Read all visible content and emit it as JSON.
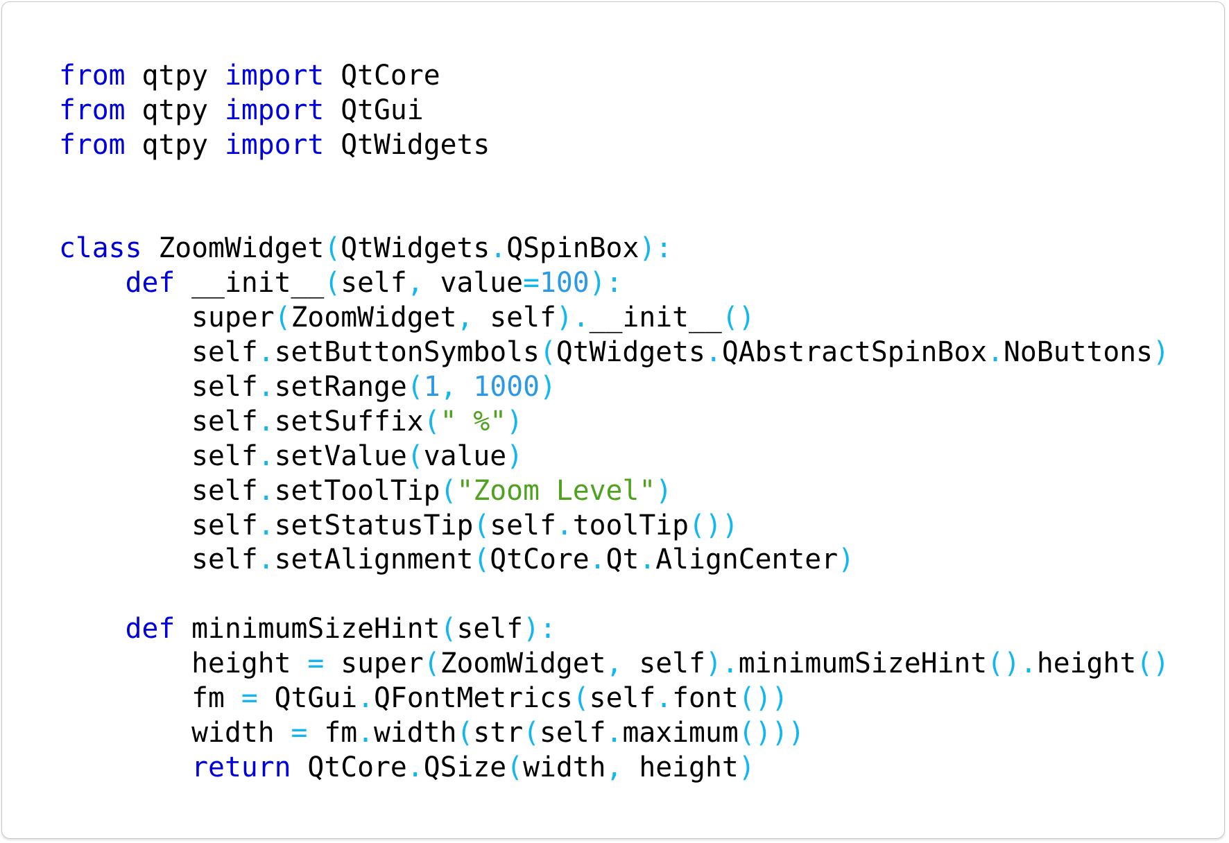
{
  "editor": {
    "language": "python",
    "colors": {
      "background": "#ffffff",
      "text": "#000000",
      "keyword": "#0000dd",
      "punctuation": "#11b7ee",
      "number": "#2b99e6",
      "string": "#4ea21e"
    },
    "lines": [
      [
        [
          "kw",
          "from"
        ],
        [
          "t",
          " qtpy "
        ],
        [
          "kw",
          "import"
        ],
        [
          "t",
          " QtCore"
        ]
      ],
      [
        [
          "kw",
          "from"
        ],
        [
          "t",
          " qtpy "
        ],
        [
          "kw",
          "import"
        ],
        [
          "t",
          " QtGui"
        ]
      ],
      [
        [
          "kw",
          "from"
        ],
        [
          "t",
          " qtpy "
        ],
        [
          "kw",
          "import"
        ],
        [
          "t",
          " QtWidgets"
        ]
      ],
      [],
      [],
      [
        [
          "kw",
          "class"
        ],
        [
          "t",
          " ZoomWidget"
        ],
        [
          "op",
          "("
        ],
        [
          "t",
          "QtWidgets"
        ],
        [
          "op",
          "."
        ],
        [
          "t",
          "QSpinBox"
        ],
        [
          "op",
          "):"
        ]
      ],
      [
        [
          "t",
          "    "
        ],
        [
          "kw",
          "def"
        ],
        [
          "t",
          " __init__"
        ],
        [
          "op",
          "("
        ],
        [
          "t",
          "self"
        ],
        [
          "op",
          ","
        ],
        [
          "t",
          " value"
        ],
        [
          "op",
          "="
        ],
        [
          "num",
          "100"
        ],
        [
          "op",
          "):"
        ]
      ],
      [
        [
          "t",
          "        super"
        ],
        [
          "op",
          "("
        ],
        [
          "t",
          "ZoomWidget"
        ],
        [
          "op",
          ","
        ],
        [
          "t",
          " self"
        ],
        [
          "op",
          ")."
        ],
        [
          "t",
          "__init__"
        ],
        [
          "op",
          "()"
        ]
      ],
      [
        [
          "t",
          "        self"
        ],
        [
          "op",
          "."
        ],
        [
          "t",
          "setButtonSymbols"
        ],
        [
          "op",
          "("
        ],
        [
          "t",
          "QtWidgets"
        ],
        [
          "op",
          "."
        ],
        [
          "t",
          "QAbstractSpinBox"
        ],
        [
          "op",
          "."
        ],
        [
          "t",
          "NoButtons"
        ],
        [
          "op",
          ")"
        ]
      ],
      [
        [
          "t",
          "        self"
        ],
        [
          "op",
          "."
        ],
        [
          "t",
          "setRange"
        ],
        [
          "op",
          "("
        ],
        [
          "num",
          "1"
        ],
        [
          "op",
          ","
        ],
        [
          "t",
          " "
        ],
        [
          "num",
          "1000"
        ],
        [
          "op",
          ")"
        ]
      ],
      [
        [
          "t",
          "        self"
        ],
        [
          "op",
          "."
        ],
        [
          "t",
          "setSuffix"
        ],
        [
          "op",
          "("
        ],
        [
          "str",
          "\" %\""
        ],
        [
          "op",
          ")"
        ]
      ],
      [
        [
          "t",
          "        self"
        ],
        [
          "op",
          "."
        ],
        [
          "t",
          "setValue"
        ],
        [
          "op",
          "("
        ],
        [
          "t",
          "value"
        ],
        [
          "op",
          ")"
        ]
      ],
      [
        [
          "t",
          "        self"
        ],
        [
          "op",
          "."
        ],
        [
          "t",
          "setToolTip"
        ],
        [
          "op",
          "("
        ],
        [
          "str",
          "\"Zoom Level\""
        ],
        [
          "op",
          ")"
        ]
      ],
      [
        [
          "t",
          "        self"
        ],
        [
          "op",
          "."
        ],
        [
          "t",
          "setStatusTip"
        ],
        [
          "op",
          "("
        ],
        [
          "t",
          "self"
        ],
        [
          "op",
          "."
        ],
        [
          "t",
          "toolTip"
        ],
        [
          "op",
          "())"
        ]
      ],
      [
        [
          "t",
          "        self"
        ],
        [
          "op",
          "."
        ],
        [
          "t",
          "setAlignment"
        ],
        [
          "op",
          "("
        ],
        [
          "t",
          "QtCore"
        ],
        [
          "op",
          "."
        ],
        [
          "t",
          "Qt"
        ],
        [
          "op",
          "."
        ],
        [
          "t",
          "AlignCenter"
        ],
        [
          "op",
          ")"
        ]
      ],
      [],
      [
        [
          "t",
          "    "
        ],
        [
          "kw",
          "def"
        ],
        [
          "t",
          " minimumSizeHint"
        ],
        [
          "op",
          "("
        ],
        [
          "t",
          "self"
        ],
        [
          "op",
          "):"
        ]
      ],
      [
        [
          "t",
          "        height "
        ],
        [
          "op",
          "="
        ],
        [
          "t",
          " super"
        ],
        [
          "op",
          "("
        ],
        [
          "t",
          "ZoomWidget"
        ],
        [
          "op",
          ","
        ],
        [
          "t",
          " self"
        ],
        [
          "op",
          ")."
        ],
        [
          "t",
          "minimumSizeHint"
        ],
        [
          "op",
          "()."
        ],
        [
          "t",
          "height"
        ],
        [
          "op",
          "()"
        ]
      ],
      [
        [
          "t",
          "        fm "
        ],
        [
          "op",
          "="
        ],
        [
          "t",
          " QtGui"
        ],
        [
          "op",
          "."
        ],
        [
          "t",
          "QFontMetrics"
        ],
        [
          "op",
          "("
        ],
        [
          "t",
          "self"
        ],
        [
          "op",
          "."
        ],
        [
          "t",
          "font"
        ],
        [
          "op",
          "())"
        ]
      ],
      [
        [
          "t",
          "        width "
        ],
        [
          "op",
          "="
        ],
        [
          "t",
          " fm"
        ],
        [
          "op",
          "."
        ],
        [
          "t",
          "width"
        ],
        [
          "op",
          "("
        ],
        [
          "t",
          "str"
        ],
        [
          "op",
          "("
        ],
        [
          "t",
          "self"
        ],
        [
          "op",
          "."
        ],
        [
          "t",
          "maximum"
        ],
        [
          "op",
          "()))"
        ]
      ],
      [
        [
          "t",
          "        "
        ],
        [
          "kw",
          "return"
        ],
        [
          "t",
          " QtCore"
        ],
        [
          "op",
          "."
        ],
        [
          "t",
          "QSize"
        ],
        [
          "op",
          "("
        ],
        [
          "t",
          "width"
        ],
        [
          "op",
          ","
        ],
        [
          "t",
          " height"
        ],
        [
          "op",
          ")"
        ]
      ]
    ]
  }
}
